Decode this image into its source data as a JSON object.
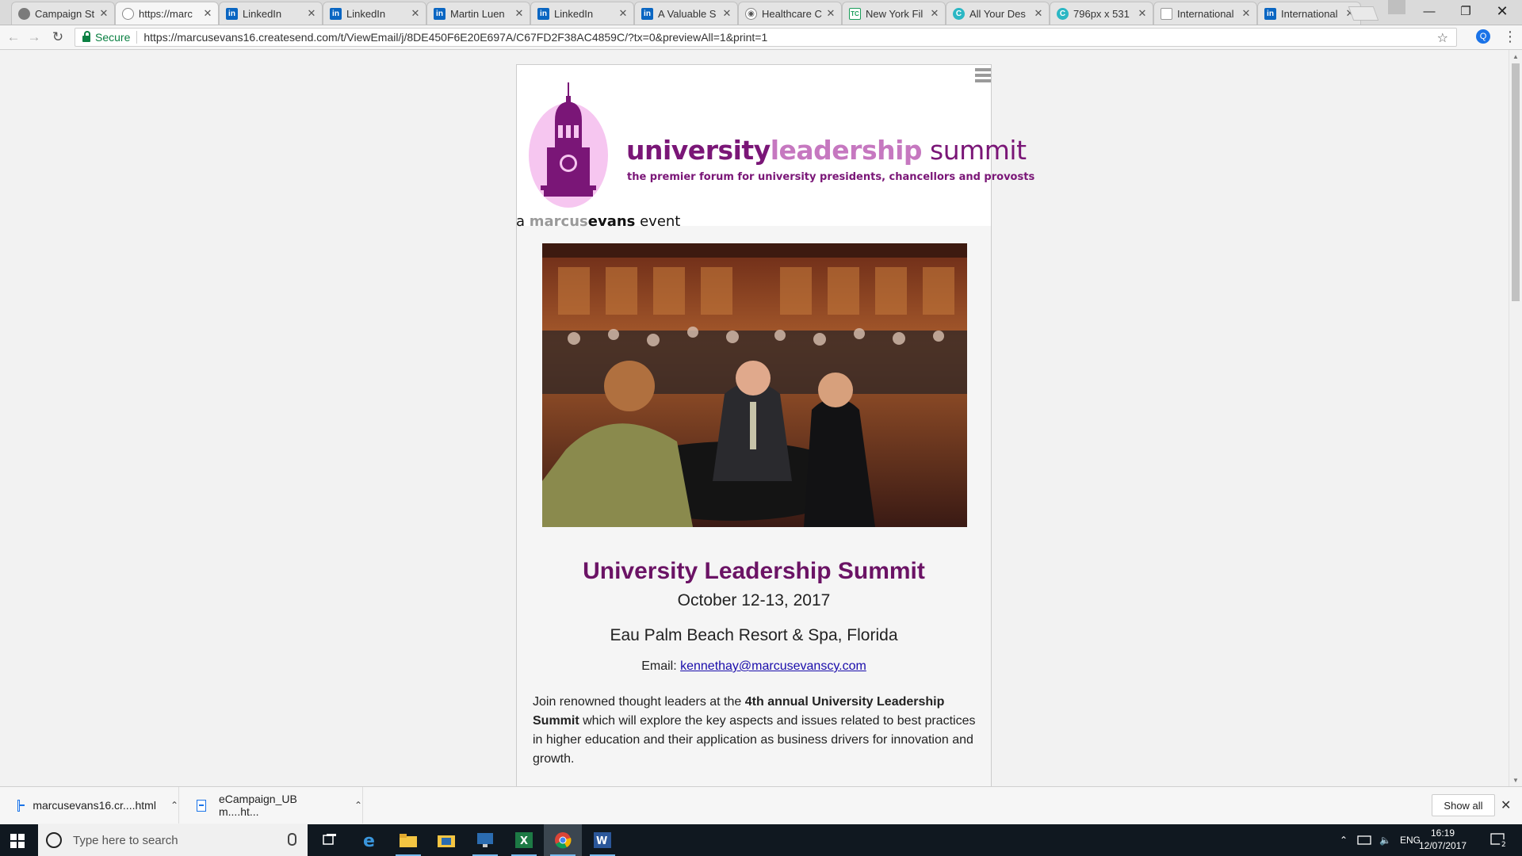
{
  "browser": {
    "tabs": [
      {
        "label": "Campaign St",
        "icon": "campaign-monitor-icon"
      },
      {
        "label": "https://marc",
        "icon": "globe-icon",
        "active": true
      },
      {
        "label": "LinkedIn",
        "icon": "linkedin-icon"
      },
      {
        "label": "LinkedIn",
        "icon": "linkedin-icon"
      },
      {
        "label": "Martin Luen",
        "icon": "linkedin-icon"
      },
      {
        "label": "LinkedIn",
        "icon": "linkedin-icon"
      },
      {
        "label": "A Valuable S",
        "icon": "linkedin-icon"
      },
      {
        "label": "Healthcare C",
        "icon": "healthcare-icon"
      },
      {
        "label": "New York Fil",
        "icon": "techcrunch-icon"
      },
      {
        "label": "All Your Des",
        "icon": "canva-icon"
      },
      {
        "label": "796px x 531",
        "icon": "canva-icon"
      },
      {
        "label": "International",
        "icon": "document-icon"
      },
      {
        "label": "International",
        "icon": "linkedin-icon"
      }
    ],
    "secure_label": "Secure",
    "url": "https://marcusevans16.createsend.com/t/ViewEmail/j/8DE450F6E20E697A/C67FD2F38AC4859C/?tx=0&previewAll=1&print=1",
    "extension_letter": "Q"
  },
  "email": {
    "wordmark": {
      "part1": "university",
      "part2": "leadership",
      "part3": " summit"
    },
    "tagline": "the premier forum for university presidents, chancellors and provosts",
    "organizer": {
      "prefix": "a ",
      "brand1": "marcus",
      "brand2": "evans",
      "suffix": " event"
    },
    "title": "University Leadership Summit",
    "date": "October 12-13, 2017",
    "venue": "Eau Palm Beach Resort & Spa, Florida",
    "email_label": "Email: ",
    "email_address": "kennethay@marcusevanscy.com",
    "intro": {
      "lead": "Join renowned thought leaders at the ",
      "bold": "4th annual University Leadership Summit",
      "rest": " which will explore the key aspects and issues related to best practices in higher education and their application as business drivers for innovation and growth."
    },
    "brand_colors": {
      "purple": "#7a1677",
      "light_purple": "#c678c0",
      "pink": "#f6c6f0"
    }
  },
  "downloads": {
    "items": [
      {
        "name": "marcusevans16.cr....html"
      },
      {
        "name": "eCampaign_UB m....ht..."
      }
    ],
    "show_all": "Show all"
  },
  "taskbar": {
    "search_placeholder": "Type here to search",
    "language": "ENG",
    "time": "16:19",
    "date": "12/07/2017",
    "notification_count": "2"
  }
}
